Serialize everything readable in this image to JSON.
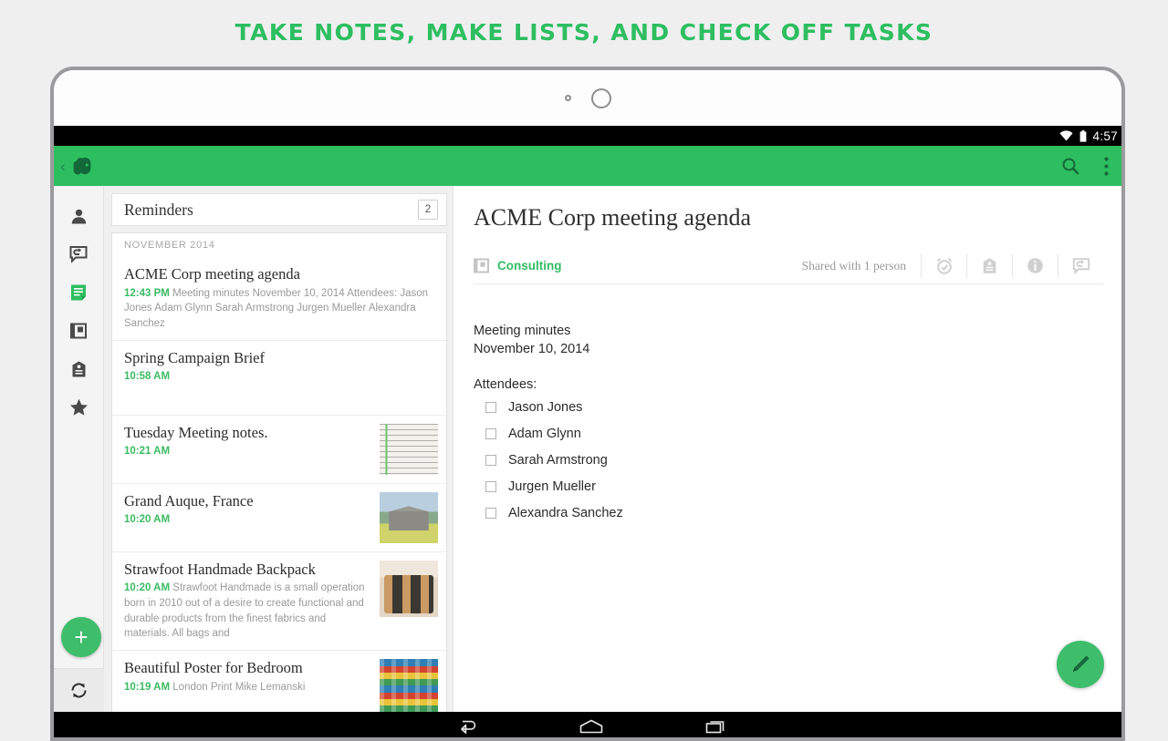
{
  "headline": "TAKE NOTES, MAKE LISTS, AND CHECK OFF TASKS",
  "colors": {
    "brand_green": "#2DBE60",
    "accent_green": "#3cba63",
    "fab_green": "#3ebd6b",
    "page_bg": "#efeff0"
  },
  "statusbar": {
    "wifi_icon": "wifi-icon",
    "battery_icon": "battery-icon",
    "clock": "4:57"
  },
  "appbar": {
    "back_chevron": "‹",
    "logo_icon": "evernote-elephant-icon",
    "search_icon": "search-icon",
    "overflow_icon": "overflow-menu-icon"
  },
  "rail": {
    "items": [
      {
        "icon": "account-icon",
        "name": "account",
        "active": false
      },
      {
        "icon": "chat-shortcut-icon",
        "name": "work-chat",
        "active": false
      },
      {
        "icon": "notes-icon",
        "name": "notes",
        "active": true
      },
      {
        "icon": "notebooks-icon",
        "name": "notebooks",
        "active": false
      },
      {
        "icon": "tags-icon",
        "name": "tags",
        "active": false
      },
      {
        "icon": "star-icon",
        "name": "shortcuts",
        "active": false
      }
    ],
    "add_button_label": "+",
    "sync_icon": "sync-icon"
  },
  "list": {
    "reminders_label": "Reminders",
    "reminders_count": "2",
    "section_header": "NOVEMBER 2014",
    "notes": [
      {
        "title": "ACME Corp meeting agenda",
        "time": "12:43 PM",
        "snippet": "Meeting minutes November 10, 2014 Attendees: Jason Jones Adam Glynn Sarah Armstrong Jurgen Mueller Alexandra Sanchez",
        "thumb": "none"
      },
      {
        "title": "Spring Campaign Brief",
        "time": "10:58 AM",
        "snippet": "",
        "thumb": "none"
      },
      {
        "title": "Tuesday Meeting notes.",
        "time": "10:21 AM",
        "snippet": "",
        "thumb": "handwritten-notes-thumbnail"
      },
      {
        "title": "Grand Auque, France",
        "time": "10:20 AM",
        "snippet": "",
        "thumb": "barn-photo-thumbnail"
      },
      {
        "title": "Strawfoot Handmade Backpack",
        "time": "10:20 AM",
        "snippet": "Strawfoot Handmade is a small operation born in 2010 out of a desire to create functional and durable products from the finest fabrics and materials. All bags and",
        "thumb": "backpack-photo-thumbnail"
      },
      {
        "title": "Beautiful  Poster for Bedroom",
        "time": "10:19 AM",
        "snippet": "London Print Mike Lemanski",
        "thumb": "poster-art-thumbnail"
      }
    ]
  },
  "detail": {
    "title": "ACME Corp meeting agenda",
    "notebook_icon": "notebook-icon",
    "notebook": "Consulting",
    "shared_text": "Shared with 1 person",
    "toolbar_icons": [
      "reminder-alarm-icon",
      "tag-icon",
      "info-icon",
      "share-chat-icon"
    ],
    "body": {
      "line1": "Meeting minutes",
      "line2": "November 10, 2014",
      "attendees_label": "Attendees:",
      "attendees": [
        {
          "name": "Jason Jones",
          "checked": false
        },
        {
          "name": "Adam Glynn",
          "checked": false
        },
        {
          "name": "Sarah Armstrong",
          "checked": false
        },
        {
          "name": "Jurgen Mueller",
          "checked": false
        },
        {
          "name": "Alexandra Sanchez",
          "checked": false
        }
      ]
    },
    "edit_icon": "pencil-icon"
  },
  "navbar": {
    "back_icon": "android-back-icon",
    "home_icon": "android-home-icon",
    "recents_icon": "android-recents-icon"
  }
}
